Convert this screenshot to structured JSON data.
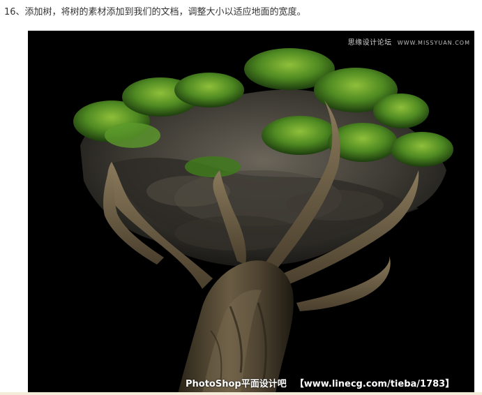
{
  "article": {
    "step_text": "16、添加树，将树的素材添加到我们的文档，调整大小以适应地面的宽度。"
  },
  "figure": {
    "background": "#000000",
    "watermark_top_cn": "思缘设计论坛",
    "watermark_top_url": "WWW.MISSYUAN.COM",
    "watermark_bottom_site": "PhotoShop平面设计吧",
    "watermark_bottom_url": "【www.linecg.com/tieba/1783】"
  }
}
